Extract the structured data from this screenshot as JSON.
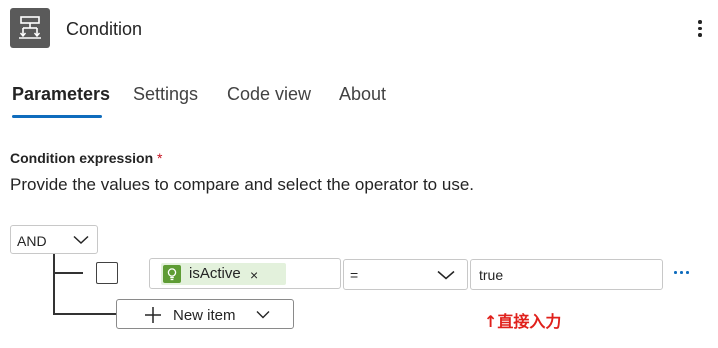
{
  "header": {
    "title": "Condition",
    "icon": "condition-icon",
    "more_icon": "more-vertical-icon"
  },
  "tabs": [
    {
      "label": "Parameters",
      "active": true
    },
    {
      "label": "Settings",
      "active": false
    },
    {
      "label": "Code view",
      "active": false
    },
    {
      "label": "About",
      "active": false
    }
  ],
  "condition": {
    "label": "Condition expression",
    "required_marker": "*",
    "description": "Provide the values to compare and select the operator to use.",
    "group_operator": "AND",
    "row": {
      "left_token": {
        "label": "isActive",
        "remove": "×",
        "icon": "expression-token-icon"
      },
      "operator": "=",
      "right_value": "true"
    },
    "new_item_label": "New item"
  },
  "annotation": "↑直接入力",
  "colors": {
    "accent": "#0f6cbd",
    "token_bg": "#e3f1dc",
    "token_icon": "#5e9c34",
    "header_icon_bg": "#5a5a5a",
    "annotation": "#e0201b",
    "required": "#c50f1f"
  }
}
